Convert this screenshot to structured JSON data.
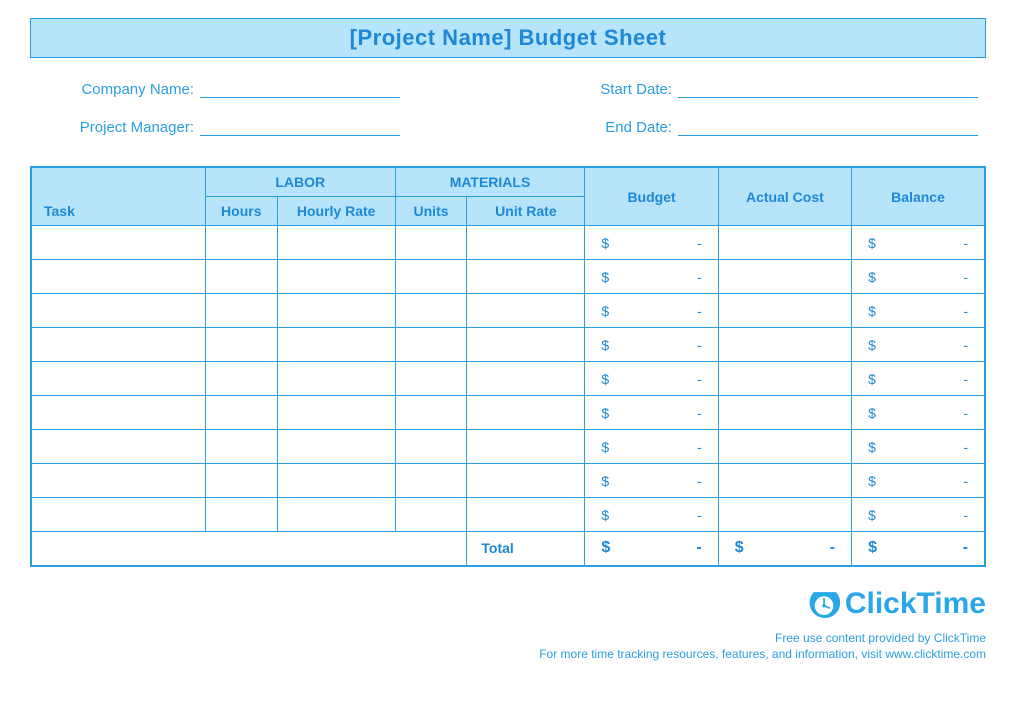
{
  "title": "[Project Name] Budget Sheet",
  "meta": {
    "company_label": "Company Name:",
    "manager_label": "Project Manager:",
    "start_label": "Start Date:",
    "end_label": "End Date:"
  },
  "headers": {
    "task": "Task",
    "labor": "LABOR",
    "hours": "Hours",
    "hourly_rate": "Hourly Rate",
    "materials": "MATERIALS",
    "units": "Units",
    "unit_rate": "Unit Rate",
    "budget": "Budget",
    "actual_cost": "Actual Cost",
    "balance": "Balance"
  },
  "money": {
    "symbol": "$",
    "dash": "-"
  },
  "total_label": "Total",
  "logo_text": "ClickTime",
  "footer1": "Free use content provided by ClickTime",
  "footer2": "For more time tracking resources, features, and information, visit www.clicktime.com"
}
